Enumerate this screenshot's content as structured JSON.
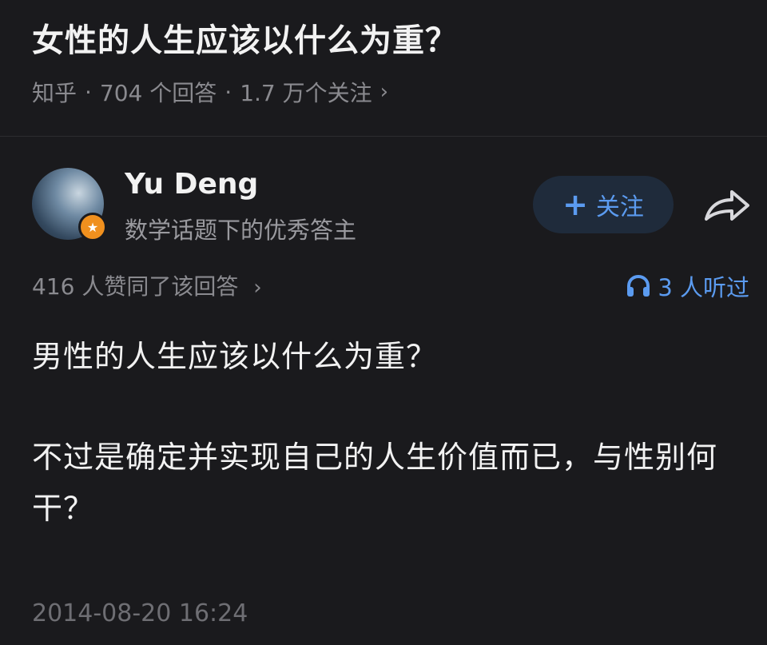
{
  "question": {
    "title": "女性的人生应该以什么为重？",
    "source": "知乎",
    "separator": "·",
    "answers": "704 个回答",
    "followers": "1.7 万个关注",
    "chevron": "›"
  },
  "author": {
    "name": "Yu Deng",
    "description": "数学话题下的优秀答主",
    "avatar_icon": "user-avatar",
    "badge_icon": "star-badge-icon",
    "follow_plus": "+",
    "follow_label": "关注",
    "share_icon": "share-arrow-icon"
  },
  "stats": {
    "agree": "416 人赞同了该回答",
    "chevron": "›",
    "headphone_icon": "headphone-icon",
    "listened": "3 人听过"
  },
  "answer": {
    "paragraphs": [
      "男性的人生应该以什么为重？",
      "不过是确定并实现自己的人生价值而已，与性别何干？"
    ],
    "timestamp": "2014-08-20 16:24"
  },
  "colors": {
    "background": "#1a1a1d",
    "accent": "#5b9bf0",
    "badge": "#f0901e"
  }
}
